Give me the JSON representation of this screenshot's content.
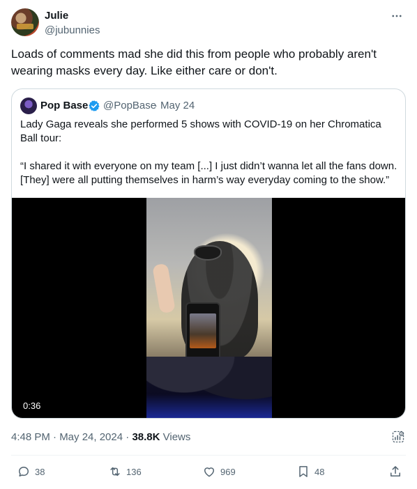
{
  "tweet": {
    "author_name": "Julie",
    "author_handle": "@jubunnies",
    "text": "Loads of comments mad she did this from people who probably aren't wearing masks every day. Like either care or don't.",
    "timestamp": "4:48 PM · May 24, 2024",
    "views_count": "38.8K",
    "views_label": "Views"
  },
  "quoted": {
    "author_name": "Pop Base",
    "author_handle": "@PopBase",
    "separator": "·",
    "date": "May 24",
    "text_p1": "Lady Gaga reveals she performed 5 shows with COVID-19 on her Chromatica Ball tour:",
    "text_p2": "“I shared it with everyone on my team [...] I just didn’t wanna let all the fans down. [They] were all putting themselves in harm’s way everyday coming to the show.”",
    "video_duration": "0:36",
    "verified": true
  },
  "actions": {
    "reply_count": "38",
    "retweet_count": "136",
    "like_count": "969",
    "bookmark_count": "48"
  },
  "colors": {
    "text": "#0f1419",
    "muted": "#536471",
    "border": "#cfd9de",
    "verified": "#1d9bf0"
  },
  "icons": [
    "more-icon",
    "verified-icon",
    "analytics-icon",
    "reply-icon",
    "retweet-icon",
    "like-icon",
    "bookmark-icon",
    "share-icon"
  ]
}
